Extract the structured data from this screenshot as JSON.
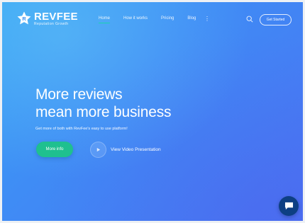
{
  "brand": {
    "name": "REVFEE",
    "tagline": "Reputation Growth",
    "accent": "#1fc08f"
  },
  "nav": {
    "items": [
      {
        "label": "Home",
        "active": true
      },
      {
        "label": "How it works",
        "active": false
      },
      {
        "label": "Pricing",
        "active": false
      },
      {
        "label": "Blog",
        "active": false
      }
    ],
    "more_icon": "kebab-icon",
    "search_icon": "search-icon",
    "cta_label": "Get Started"
  },
  "hero": {
    "headline_line1": "More reviews",
    "headline_line2": "mean more business",
    "subtitle": "Get more of both with RevFee's easy to use platform!",
    "primary_button": "More info",
    "video_label": "View Video Presentation",
    "play_icon": "play-icon"
  },
  "chat": {
    "icon": "chat-icon",
    "color": "#0d3f83"
  }
}
